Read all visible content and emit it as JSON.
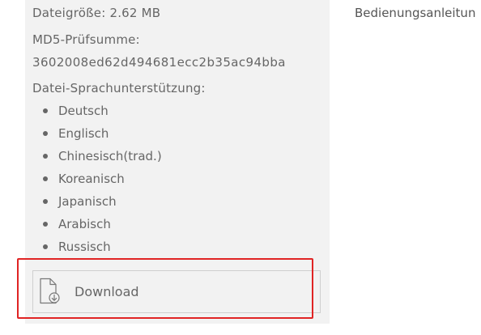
{
  "file_info": {
    "size_line": "Dateigröße: 2.62 MB",
    "md5_label": "MD5-Prüfsumme:",
    "md5_value": "3602008ed62d494681ecc2b35ac94bba",
    "language_label": "Datei-Sprachunterstützung:",
    "languages": [
      "Deutsch",
      "Englisch",
      "Chinesisch(trad.)",
      "Koreanisch",
      "Japanisch",
      "Arabisch",
      "Russisch"
    ]
  },
  "sidebar": {
    "manual_link": "Bedienungsanleitun"
  },
  "download": {
    "label": "Download",
    "icon": "file-download-icon"
  },
  "colors": {
    "panel_bg": "#f2f2f2",
    "text": "#666666",
    "highlight": "#e02424"
  }
}
